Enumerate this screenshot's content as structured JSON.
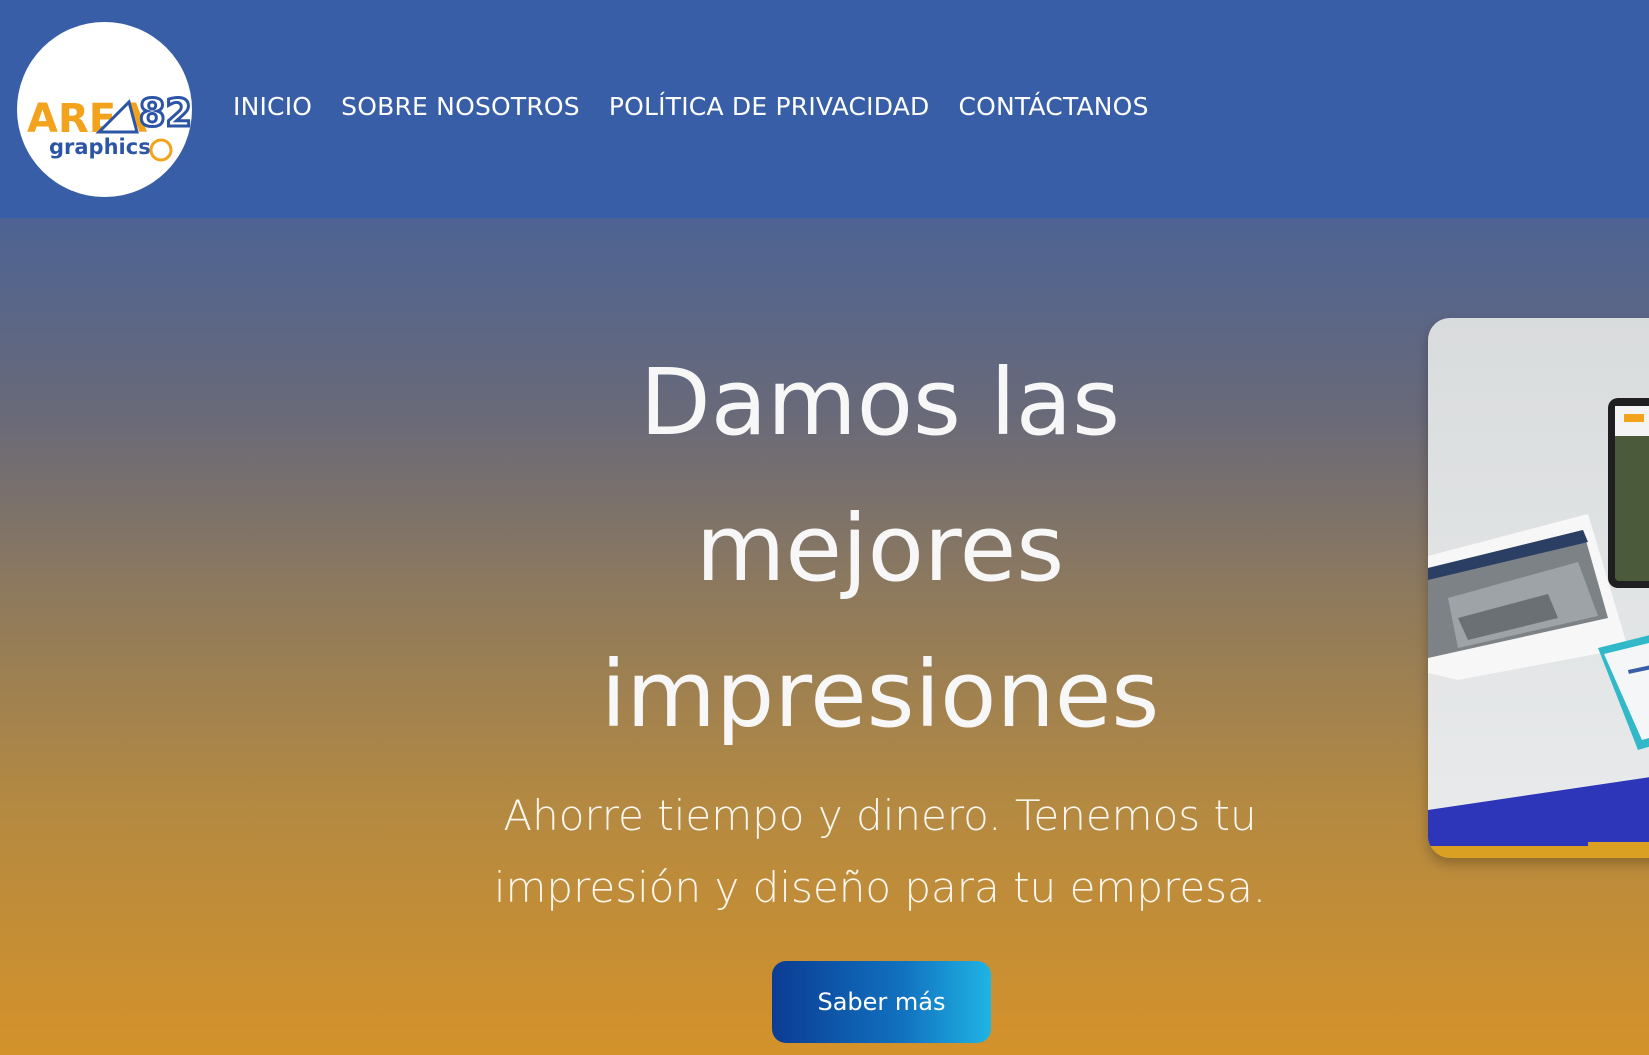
{
  "logo": {
    "text_main": "AREA",
    "text_sub": "graphics",
    "text_num": "82"
  },
  "nav": {
    "items": [
      {
        "label": "INICIO"
      },
      {
        "label": "SOBRE NOSOTROS"
      },
      {
        "label": "POLÍTICA DE PRIVACIDAD"
      },
      {
        "label": "CONTÁCTANOS"
      }
    ]
  },
  "hero": {
    "title_line1": "Damos las",
    "title_line2": "mejores",
    "title_line3": "impresiones",
    "subtitle_line1": "Ahorre tiempo y dinero. Tenemos tu",
    "subtitle_line2": "impresión y diseño para tu empresa.",
    "cta_label": "Saber más"
  },
  "colors": {
    "header_bg": "#375ea6",
    "accent_orange": "#f3a21b",
    "cta_start": "#0b3c93",
    "cta_end": "#20b4e4"
  }
}
